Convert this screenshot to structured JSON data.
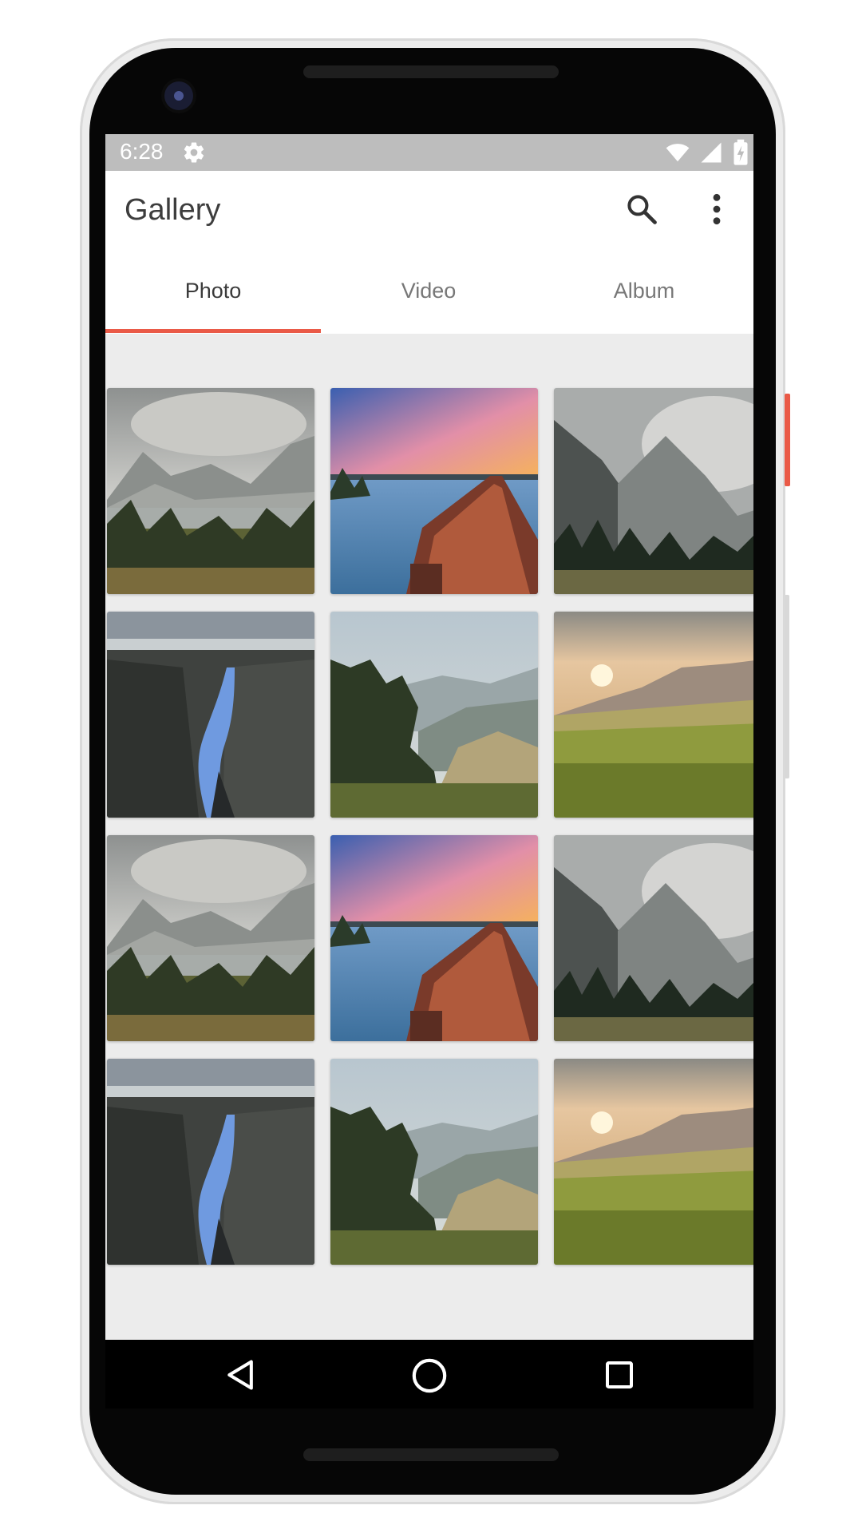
{
  "status_bar": {
    "time": "6:28",
    "icons": [
      "gear-icon",
      "wifi-icon",
      "signal-icon",
      "battery-icon"
    ]
  },
  "app_bar": {
    "title": "Gallery",
    "actions": [
      "search-icon",
      "more-vertical-icon"
    ]
  },
  "tabs": [
    {
      "label": "Photo",
      "active": true
    },
    {
      "label": "Video",
      "active": false
    },
    {
      "label": "Album",
      "active": false
    }
  ],
  "photos": [
    "mountain lake with clouds",
    "wooden pier at sunset",
    "misty mountain forest",
    "canyon with blue river",
    "valley with pine trees",
    "sunset over grass meadow",
    "mountain lake with clouds",
    "wooden pier at sunset",
    "misty mountain forest",
    "canyon with blue river",
    "valley with pine trees",
    "sunset over grass meadow"
  ],
  "nav_bar": {
    "icons": [
      "back-icon",
      "home-icon",
      "recents-icon"
    ]
  },
  "colors": {
    "accent": "#ea5a47",
    "status_bar": "#bdbdbd",
    "app_background": "#ececec",
    "title_text": "#3d3d3d"
  }
}
